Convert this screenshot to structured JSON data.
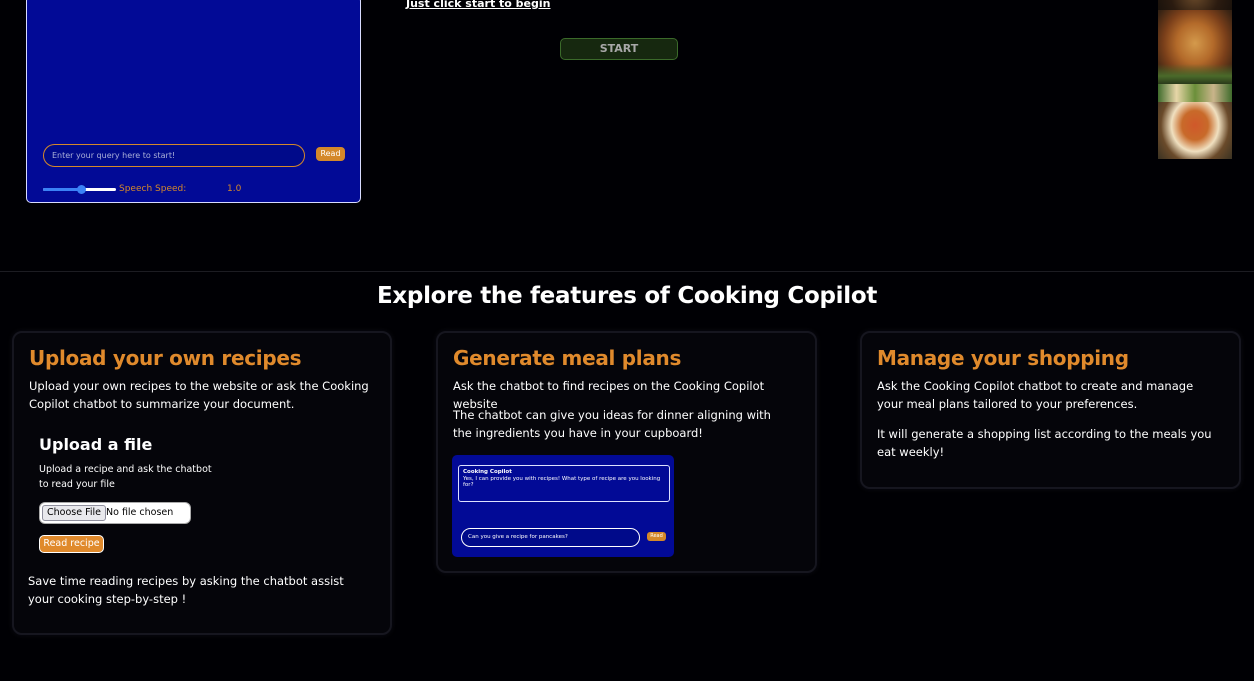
{
  "chat": {
    "query_placeholder": "Enter your query here to start!",
    "read_label": "Read",
    "speech_speed_label": "Speech Speed:",
    "speech_speed_value": "1.0",
    "speech_speed_fraction": 0.5
  },
  "intro": {
    "start_hint": "Just click start to begin",
    "start_label": "START"
  },
  "features": {
    "title": "Explore the features of Cooking Copilot",
    "cards": [
      {
        "title": "Upload your own recipes",
        "paragraphs": [
          "Upload your own recipes to the website or ask the Cooking Copilot chatbot to summarize your document."
        ],
        "upload": {
          "title": "Upload a file",
          "desc": "Upload a recipe and ask the chatbot to read your file",
          "choose_label": "Choose File",
          "file_status": "No file chosen",
          "read_recipe_label": "Read recipe"
        },
        "footer": "Save time reading recipes by asking the chatbot assist your cooking step-by-step !"
      },
      {
        "title": "Generate meal plans",
        "paragraphs": [
          "Ask the chatbot to find recipes on the Cooking Copilot website",
          "The chatbot can give you ideas for dinner aligning with the ingredients you have in your cupboard!"
        ],
        "preview": {
          "sender": "Cooking Copilot",
          "message": "Yes, I can provide you with recipes! What type of recipe are you looking for?",
          "input": "Can you give a recipe for pancakes?",
          "read_label": "Read"
        }
      },
      {
        "title": "Manage your shopping",
        "paragraphs": [
          "Ask the Cooking Copilot chatbot to create and manage your meal plans tailored to your preferences.",
          "It will generate a shopping list according to the meals you eat weekly!"
        ]
      }
    ]
  },
  "colors": {
    "accent": "#e08a2c",
    "panel_blue": "#020a96",
    "background": "#000004"
  }
}
